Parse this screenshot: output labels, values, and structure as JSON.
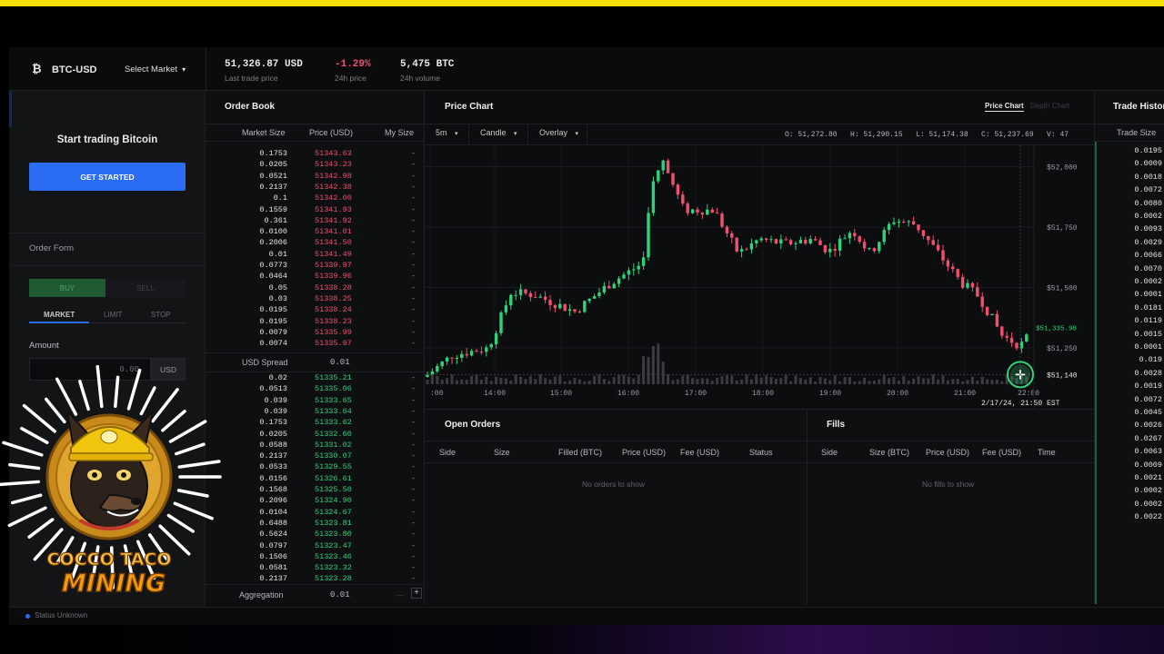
{
  "header": {
    "market": "BTC-USD",
    "select_market": "Select Market",
    "last_price": "51,326.87 USD",
    "last_price_label": "Last trade price",
    "change": "-1.29%",
    "change_label": "24h price",
    "volume": "5,475 BTC",
    "volume_label": "24h volume"
  },
  "left": {
    "headline": "Start trading Bitcoin",
    "get_started": "GET STARTED",
    "order_form": "Order Form",
    "buy": "BUY",
    "sell": "SELL",
    "tabs": [
      "MARKET",
      "LIMIT",
      "STOP"
    ],
    "amount_label": "Amount",
    "amount_value": "0.00",
    "amount_unit": "USD",
    "status": "Status Unknown"
  },
  "orderbook": {
    "title": "Order Book",
    "col_size": "Market Size",
    "col_price": "Price (USD)",
    "col_my": "My Size",
    "asks": [
      {
        "size": "0.1753",
        "price": "51343.63"
      },
      {
        "size": "0.0205",
        "price": "51343.23"
      },
      {
        "size": "0.0521",
        "price": "51342.98"
      },
      {
        "size": "0.2137",
        "price": "51342.38"
      },
      {
        "size": "0.1",
        "price": "51342.00"
      },
      {
        "size": "0.1559",
        "price": "51341.93"
      },
      {
        "size": "0.361",
        "price": "51341.92"
      },
      {
        "size": "0.0100",
        "price": "51341.01"
      },
      {
        "size": "0.2006",
        "price": "51341.50"
      },
      {
        "size": "0.01",
        "price": "51341.49"
      },
      {
        "size": "0.0773",
        "price": "51339.97"
      },
      {
        "size": "0.0464",
        "price": "51339.96"
      },
      {
        "size": "0.05",
        "price": "51338.28"
      },
      {
        "size": "0.03",
        "price": "51338.25"
      },
      {
        "size": "0.0195",
        "price": "51338.24"
      },
      {
        "size": "0.0195",
        "price": "51338.23"
      },
      {
        "size": "0.0079",
        "price": "51335.99"
      },
      {
        "size": "0.0074",
        "price": "51335.97"
      }
    ],
    "my_dash": "-",
    "spread_label": "USD Spread",
    "spread_value": "0.01",
    "bids": [
      {
        "size": "0.02",
        "price": "51335.21"
      },
      {
        "size": "0.0513",
        "price": "51335.06"
      },
      {
        "size": "0.039",
        "price": "51333.65"
      },
      {
        "size": "0.039",
        "price": "51333.64"
      },
      {
        "size": "0.1753",
        "price": "51333.62"
      },
      {
        "size": "0.0205",
        "price": "51332.60"
      },
      {
        "size": "0.0588",
        "price": "51331.02"
      },
      {
        "size": "0.2137",
        "price": "51330.07"
      },
      {
        "size": "0.0533",
        "price": "51329.55"
      },
      {
        "size": "0.0156",
        "price": "51326.61"
      },
      {
        "size": "0.1568",
        "price": "51325.50"
      },
      {
        "size": "0.2096",
        "price": "51324.90"
      },
      {
        "size": "0.0104",
        "price": "51324.67"
      },
      {
        "size": "0.6488",
        "price": "51323.81"
      },
      {
        "size": "0.5624",
        "price": "51323.80"
      },
      {
        "size": "0.0797",
        "price": "51323.47"
      },
      {
        "size": "0.1506",
        "price": "51323.46"
      },
      {
        "size": "0.0581",
        "price": "51323.32"
      },
      {
        "size": "0.2137",
        "price": "51323.28"
      }
    ],
    "aggregation_label": "Aggregation",
    "aggregation_value": "0.01",
    "aggregation_minus": "—",
    "aggregation_plus": "+"
  },
  "chart": {
    "title": "Price Chart",
    "tab_price": "Price Chart",
    "tab_depth": "Depth Chart",
    "interval": "5m",
    "style": "Candle",
    "overlay": "Overlay",
    "ohlcv": "O: 51,272.80   H: 51,290.15   L: 51,174.38   C: 51,237.69   V: 47",
    "y_labels": [
      "$52,000",
      "$51,750",
      "$51,500",
      "$51,250",
      "$51,140"
    ],
    "x_labels": [
      ":00",
      "14:00",
      "15:00",
      "16:00",
      "17:00",
      "18:00",
      "19:00",
      "20:00",
      "21:00",
      "22:00"
    ],
    "last_price_tag": "$51,335.98",
    "crosshair_time": "2/17/24, 21:50 EST",
    "colors": {
      "up": "#2fd37a",
      "down": "#f0506e",
      "volume": "#3a3c42"
    }
  },
  "open_orders": {
    "title": "Open Orders",
    "cols": [
      "Side",
      "Size",
      "Filled (BTC)",
      "Price (USD)",
      "Fee (USD)",
      "Status"
    ],
    "empty": "No orders to show"
  },
  "fills": {
    "title": "Fills",
    "cols": [
      "Side",
      "Size (BTC)",
      "Price (USD)",
      "Fee (USD)",
      "Time"
    ],
    "empty": "No fills to show"
  },
  "trade_history": {
    "title": "Trade History",
    "col": "Trade Size",
    "rows": [
      "0.0195",
      "0.0009",
      "0.0018",
      "0.0072",
      "0.0080",
      "0.0002",
      "0.0093",
      "0.0029",
      "0.0066",
      "0.0070",
      "0.0002",
      "0.0001",
      "0.0181",
      "0.0119",
      "0.0015",
      "0.0001",
      "0.019",
      "0.0028",
      "0.0019",
      "0.0072",
      "0.0045",
      "0.0026",
      "0.0267",
      "0.0063",
      "0.0009",
      "0.0021",
      "0.0002",
      "0.0002",
      "0.0022"
    ]
  },
  "overlay_logo": {
    "text_line1": "COCCO TACO",
    "text_line2": "MINING"
  }
}
